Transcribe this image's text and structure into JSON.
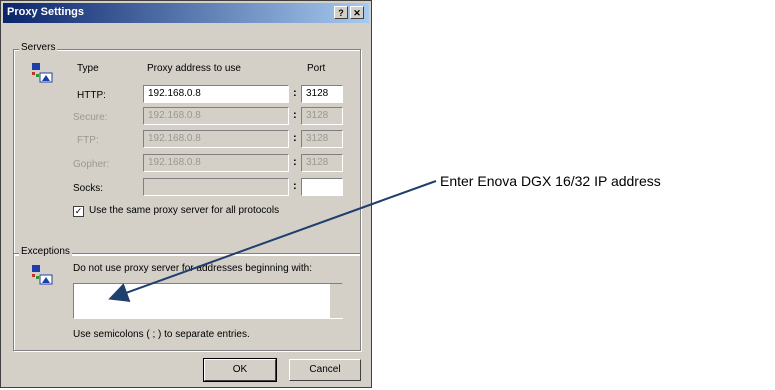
{
  "dialog": {
    "title": "Proxy Settings",
    "help_button": "?",
    "close_button": "✕"
  },
  "servers": {
    "group_label": "Servers",
    "col_type": "Type",
    "col_address": "Proxy address to use",
    "col_port": "Port",
    "rows": [
      {
        "type": "HTTP:",
        "address": "192.168.0.8",
        "port": "3128",
        "enabled": true
      },
      {
        "type": "Secure:",
        "address": "192.168.0.8",
        "port": "3128",
        "enabled": false
      },
      {
        "type": "FTP:",
        "address": "192.168.0.8",
        "port": "3128",
        "enabled": false
      },
      {
        "type": "Gopher:",
        "address": "192.168.0.8",
        "port": "3128",
        "enabled": false
      },
      {
        "type": "Socks:",
        "address": "",
        "port": "",
        "enabled": true
      }
    ],
    "same_proxy_label": "Use the same proxy server for all protocols",
    "same_proxy_checked": true
  },
  "exceptions": {
    "group_label": "Exceptions",
    "instruction": "Do not use proxy server for addresses beginning with:",
    "value": "",
    "hint": "Use semicolons ( ; ) to separate entries."
  },
  "buttons": {
    "ok": "OK",
    "cancel": "Cancel"
  },
  "annotation": {
    "text": "Enter Enova DGX 16/32 IP address",
    "color": "#1f3f6e"
  }
}
